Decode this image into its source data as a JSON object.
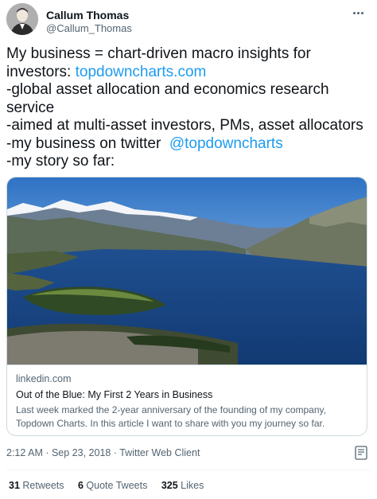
{
  "author": {
    "name": "Callum Thomas",
    "handle": "@Callum_Thomas"
  },
  "tweet": {
    "line1": "My business = chart-driven macro insights for",
    "line2_prefix": "investors: ",
    "line2_link": "topdowncharts.com",
    "line3": "-global asset allocation and economics research",
    "line4": "service",
    "line5": "-aimed at multi-asset investors, PMs, asset allocators",
    "line6_prefix": "-my business on twitter  ",
    "line6_mention": "@topdowncharts",
    "line7": "-my story so far:"
  },
  "card": {
    "domain": "linkedin.com",
    "title": "Out of the Blue: My First 2 Years in Business",
    "desc_line1": "Last week marked the 2-year anniversary of the founding of my company,",
    "desc_line2": "Topdown Charts. In this article I want to share with you my journey so far."
  },
  "meta": {
    "timestamp": "2:12 AM · Sep 23, 2018 · Twitter Web Client"
  },
  "stats": {
    "retweets_count": "31",
    "retweets_label": "Retweets",
    "quotes_count": "6",
    "quotes_label": "Quote Tweets",
    "likes_count": "325",
    "likes_label": "Likes"
  },
  "colors": {
    "link": "#1d9bf0",
    "secondary_text": "#536471",
    "primary_text": "#0f1419",
    "border": "#cfd9de"
  },
  "icons": [
    "more-icon",
    "analytics-icon"
  ]
}
